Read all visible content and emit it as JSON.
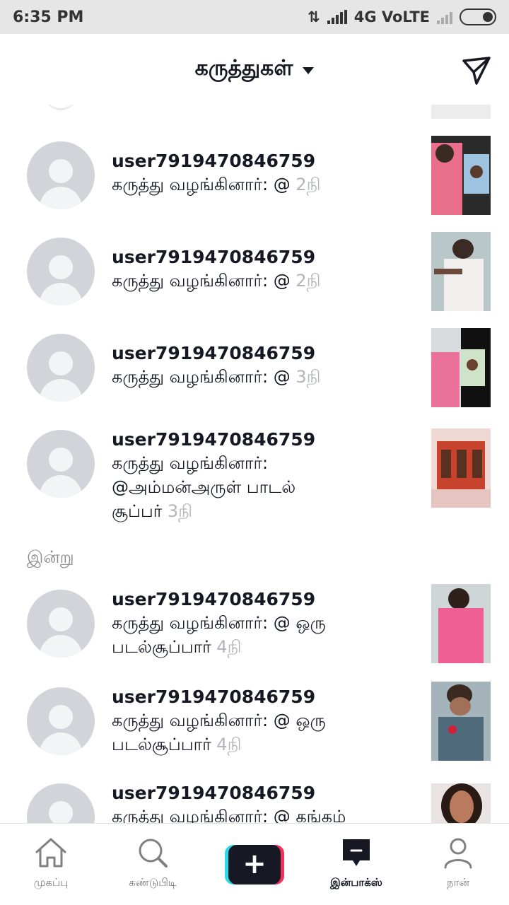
{
  "status_bar": {
    "time": "6:35 PM",
    "network": "4G VoLTE"
  },
  "header": {
    "title": "கருத்துகள்",
    "send_icon": "send-icon"
  },
  "notifications_top": [
    {
      "username": "user7919470846759",
      "line1": "கருத்து வழங்கினார்: @",
      "line2": "",
      "age": "2நி"
    },
    {
      "username": "user7919470846759",
      "line1": "கருத்து வழங்கினார்: @",
      "line2": "",
      "age": "2நி"
    },
    {
      "username": "user7919470846759",
      "line1": "கருத்து வழங்கினார்: @",
      "line2": "",
      "age": "3நி"
    },
    {
      "username": "user7919470846759",
      "line1": "கருத்து வழங்கினார்:",
      "line2": "@அம்மன்அருள் பாடல்",
      "line3": "சூப்பர்",
      "age": "3நி"
    }
  ],
  "section_today": "இன்று",
  "notifications_today": [
    {
      "username": "user7919470846759",
      "line1": "கருத்து வழங்கினார்: @ ஒரு",
      "line2": "படல்சூப்பார்",
      "age": "4நி"
    },
    {
      "username": "user7919470846759",
      "line1": "கருத்து வழங்கினார்: @ ஒரு",
      "line2": "படல்சூப்பார்",
      "age": "4நி"
    },
    {
      "username": "user7919470846759",
      "line1": "கருத்து வழங்கினார்: @ கங்கம்",
      "line2": "",
      "age": ""
    }
  ],
  "bottom_nav": [
    {
      "label": "முகப்பு",
      "icon": "home-icon"
    },
    {
      "label": "கண்டுபிடி",
      "icon": "search-icon"
    },
    {
      "label": "",
      "icon": "plus-icon"
    },
    {
      "label": "இன்பாக்ஸ்",
      "icon": "inbox-icon"
    },
    {
      "label": "நான்",
      "icon": "profile-icon"
    }
  ],
  "colors": {
    "accent_cyan": "#2bd9e8",
    "accent_pink": "#f0315c",
    "text": "#161823",
    "muted": "#b3b5ba"
  }
}
